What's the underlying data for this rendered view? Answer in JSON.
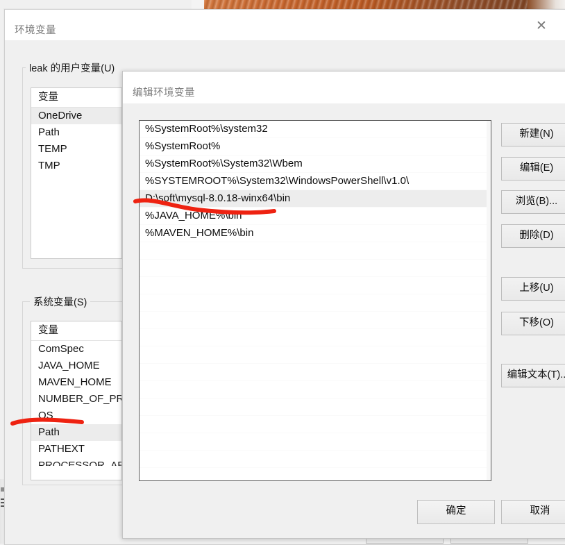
{
  "background": {
    "photo_description": "orange-brown-fur-photo-strip"
  },
  "outer_dialog": {
    "title": "环境变量",
    "close_glyph": "✕",
    "user_group_label": "leak 的用户变量(U)",
    "system_group_label": "系统变量(S)",
    "user_variables": {
      "column_header": "变量",
      "rows": [
        {
          "name": "OneDrive",
          "selected": true
        },
        {
          "name": "Path",
          "selected": false
        },
        {
          "name": "TEMP",
          "selected": false
        },
        {
          "name": "TMP",
          "selected": false
        }
      ]
    },
    "system_variables": {
      "column_header": "变量",
      "rows": [
        {
          "name": "ComSpec",
          "selected": false
        },
        {
          "name": "JAVA_HOME",
          "selected": false
        },
        {
          "name": "MAVEN_HOME",
          "selected": false
        },
        {
          "name": "NUMBER_OF_PRO",
          "selected": false
        },
        {
          "name": "OS",
          "selected": false
        },
        {
          "name": "Path",
          "selected": true
        },
        {
          "name": "PATHEXT",
          "selected": false
        },
        {
          "name": "PROCESSOR_AR",
          "selected": false
        }
      ]
    },
    "ok_label": "确定",
    "cancel_label": "取消"
  },
  "inner_dialog": {
    "title": "编辑环境变量",
    "path_entries": [
      {
        "value": "%SystemRoot%\\system32",
        "selected": false
      },
      {
        "value": "%SystemRoot%",
        "selected": false
      },
      {
        "value": "%SystemRoot%\\System32\\Wbem",
        "selected": false
      },
      {
        "value": "%SYSTEMROOT%\\System32\\WindowsPowerShell\\v1.0\\",
        "selected": false
      },
      {
        "value": "D:\\soft\\mysql-8.0.18-winx64\\bin",
        "selected": true
      },
      {
        "value": "%JAVA_HOME%\\bin",
        "selected": false
      },
      {
        "value": "%MAVEN_HOME%\\bin",
        "selected": false
      }
    ],
    "buttons": [
      {
        "label": "新建(N)"
      },
      {
        "label": "编辑(E)"
      },
      {
        "label": "浏览(B)..."
      },
      {
        "label": "删除(D)"
      },
      {
        "label": "上移(U)"
      },
      {
        "label": "下移(O)"
      },
      {
        "label": "编辑文本(T)..."
      }
    ],
    "ok_label": "确定",
    "cancel_label": "取消"
  },
  "annotations": {
    "color": "#ee2211",
    "marks": [
      {
        "name": "underline-maven-home-entry"
      },
      {
        "name": "underline-system-path-variable"
      }
    ]
  }
}
